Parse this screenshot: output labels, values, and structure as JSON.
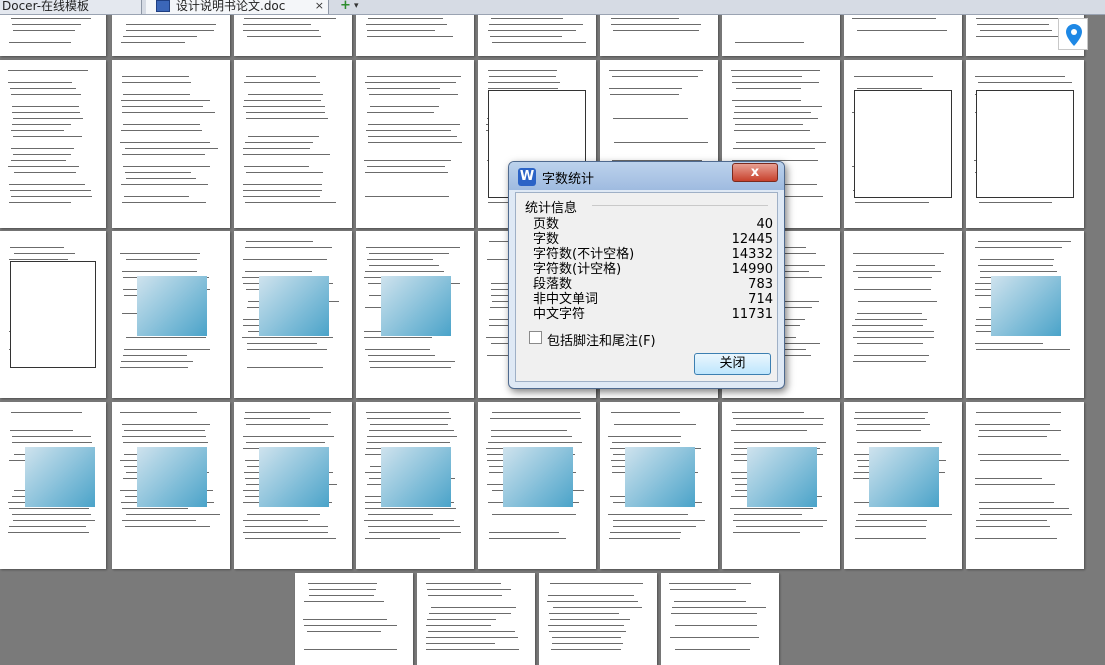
{
  "tabs": [
    {
      "label": "Docer-在线模板"
    },
    {
      "label": "设计说明书论文.doc",
      "close": "×"
    }
  ],
  "new_tab": {
    "label": "+",
    "caret": "▾"
  },
  "dialog": {
    "title": "字数统计",
    "app_icon_letter": "W",
    "close_x": "x",
    "section": "统计信息",
    "stats": [
      {
        "label": "页数",
        "value": "40"
      },
      {
        "label": "字数",
        "value": "12445"
      },
      {
        "label": "字符数(不计空格)",
        "value": "14332"
      },
      {
        "label": "字符数(计空格)",
        "value": "14990"
      },
      {
        "label": "段落数",
        "value": "783"
      },
      {
        "label": "非中文单词",
        "value": "714"
      },
      {
        "label": "中文字符",
        "value": "11731"
      }
    ],
    "checkbox_label": "包括脚注和尾注(F)",
    "checkbox_checked": false,
    "close_button": "关闭"
  },
  "colors": {
    "dialog_accent": "#2b63c6",
    "close_red": "#c7412c",
    "location_blue": "#1e88e5"
  }
}
